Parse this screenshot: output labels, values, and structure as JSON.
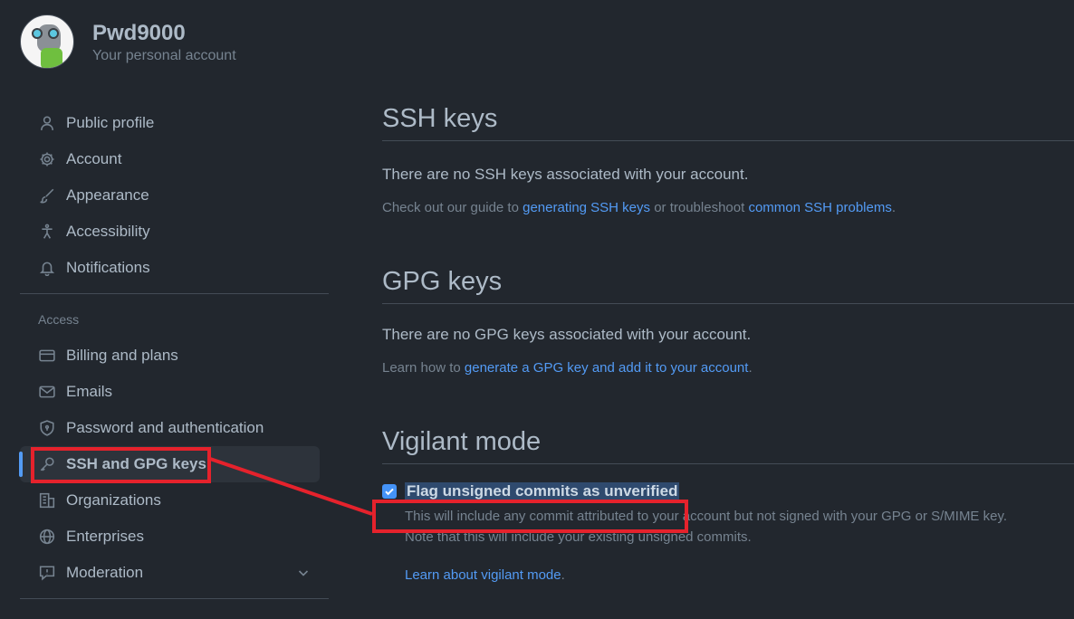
{
  "profile": {
    "name": "Pwd9000",
    "subtitle": "Your personal account"
  },
  "sidebar": {
    "items_top": [
      {
        "label": "Public profile",
        "icon": "person-icon"
      },
      {
        "label": "Account",
        "icon": "gear-icon"
      },
      {
        "label": "Appearance",
        "icon": "paintbrush-icon"
      },
      {
        "label": "Accessibility",
        "icon": "accessibility-icon"
      },
      {
        "label": "Notifications",
        "icon": "bell-icon"
      }
    ],
    "access_label": "Access",
    "items_access": [
      {
        "label": "Billing and plans",
        "icon": "credit-card-icon"
      },
      {
        "label": "Emails",
        "icon": "mail-icon"
      },
      {
        "label": "Password and authentication",
        "icon": "shield-icon"
      },
      {
        "label": "SSH and GPG keys",
        "icon": "key-icon"
      },
      {
        "label": "Organizations",
        "icon": "organization-icon"
      },
      {
        "label": "Enterprises",
        "icon": "globe-icon"
      },
      {
        "label": "Moderation",
        "icon": "report-icon"
      }
    ]
  },
  "ssh": {
    "title": "SSH keys",
    "empty": "There are no SSH keys associated with your account.",
    "guide_prefix": "Check out our guide to",
    "guide_link": "generating SSH keys",
    "guide_middle": "or troubleshoot",
    "guide_link2": "common SSH problems",
    "guide_suffix": "."
  },
  "gpg": {
    "title": "GPG keys",
    "empty": "There are no GPG keys associated with your account.",
    "learn_prefix": "Learn how to",
    "learn_link": "generate a GPG key and add it to your account",
    "learn_suffix": "."
  },
  "vigilant": {
    "title": "Vigilant mode",
    "checkbox_label": "Flag unsigned commits as unverified",
    "checked": true,
    "desc1": "This will include any commit attributed to your account but not signed with your GPG or S/MIME key.",
    "desc2": "Note that this will include your existing unsigned commits.",
    "learn_link": "Learn about vigilant mode",
    "learn_suffix": "."
  },
  "colors": {
    "accent": "#539bf5",
    "annotation": "#e5222c",
    "background": "#22272e"
  }
}
